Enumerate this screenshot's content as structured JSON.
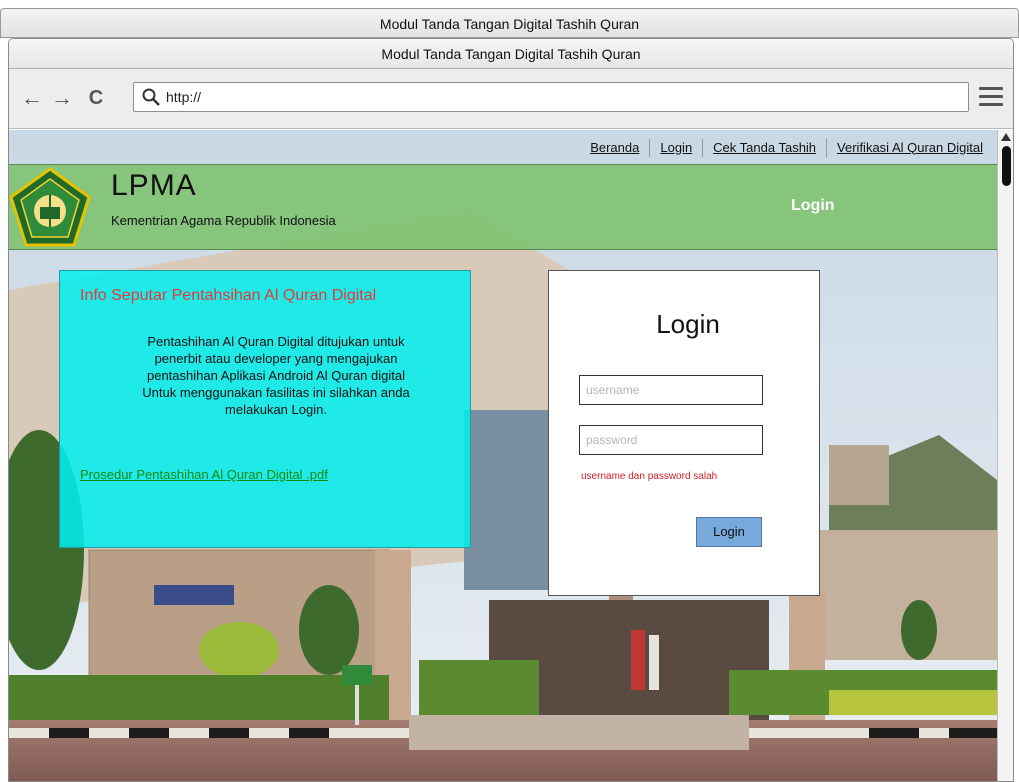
{
  "window": {
    "outer_title": "Modul Tanda Tangan Digital Tashih Quran",
    "title": "Modul Tanda Tangan Digital Tashih Quran"
  },
  "browser": {
    "back_icon": "arrow-left-icon",
    "forward_icon": "arrow-right-icon",
    "reload_icon": "reload-icon",
    "search_icon": "search-icon",
    "menu_icon": "hamburger-menu-icon",
    "address": "http://"
  },
  "topnav": {
    "items": [
      "Beranda",
      "Login",
      "Cek Tanda Tashih",
      "Verifikasi Al Quran Digital"
    ]
  },
  "header": {
    "brand": "LPMA",
    "subtitle": "Kementrian Agama Republik Indonesia",
    "right_label": "Login",
    "background": "#7fc170"
  },
  "info": {
    "title": "Info Seputar Pentahsihan Al Quran Digital",
    "lines": [
      "Pentashihan Al Quran Digital ditujukan untuk",
      "penerbit atau developer yang mengajukan",
      "pentashihan Aplikasi Android Al Quran digital",
      "Untuk menggunakan fasilitas ini silahkan anda",
      "melakukan Login."
    ],
    "link": "Prosedur Pentashihan Al Quran Digital .pdf",
    "background": "#00f0f0",
    "title_color": "#e23b3b",
    "link_color": "#118b11"
  },
  "login": {
    "title": "Login",
    "username_placeholder": "username",
    "password_placeholder": "password",
    "error": "username dan password salah",
    "button": "Login",
    "error_color": "#d0202a",
    "button_color": "#78a9dc"
  }
}
